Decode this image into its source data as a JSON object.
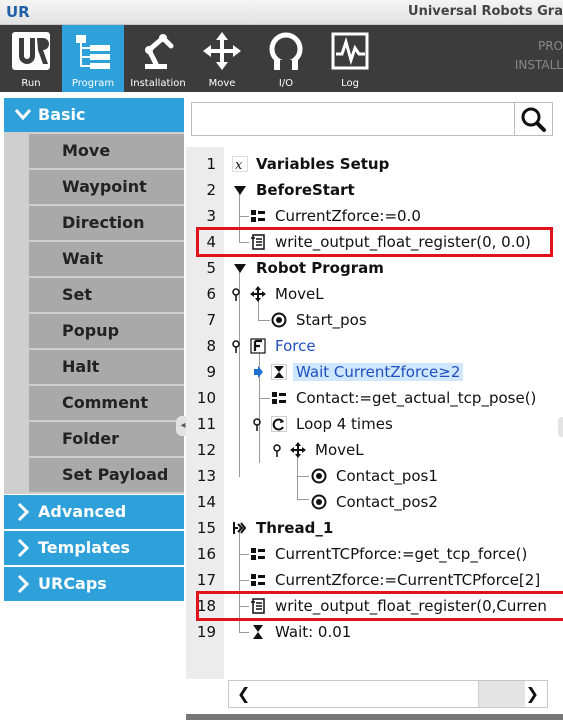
{
  "window": {
    "logo": "UR",
    "title": "Universal Robots Gra"
  },
  "toolbar": {
    "buttons": [
      {
        "label": "Run",
        "icon": "ur-logo-icon"
      },
      {
        "label": "Program",
        "icon": "program-tree-icon",
        "active": true
      },
      {
        "label": "Installation",
        "icon": "robot-arm-icon"
      },
      {
        "label": "Move",
        "icon": "move-cross-icon"
      },
      {
        "label": "I/O",
        "icon": "io-icon"
      },
      {
        "label": "Log",
        "icon": "log-waveform-icon"
      }
    ],
    "right_line1": "PRO",
    "right_line2": "INSTALL"
  },
  "sidebar": {
    "basic_label": "Basic",
    "basic_items": [
      "Move",
      "Waypoint",
      "Direction",
      "Wait",
      "Set",
      "Popup",
      "Halt",
      "Comment",
      "Folder",
      "Set Payload"
    ],
    "advanced_label": "Advanced",
    "templates_label": "Templates",
    "urcaps_label": "URCaps"
  },
  "search": {
    "placeholder": ""
  },
  "tree": {
    "rows": [
      {
        "num": "1",
        "text": "Variables Setup",
        "icon": "variable-x-icon"
      },
      {
        "num": "2",
        "text": "BeforeStart",
        "icon": "collapse-triangle-icon"
      },
      {
        "num": "3",
        "text": "CurrentZforce:=0.0",
        "icon": "assignment-icon"
      },
      {
        "num": "4",
        "text": "write_output_float_register(0, 0.0)",
        "icon": "script-icon"
      },
      {
        "num": "5",
        "text": "Robot Program",
        "icon": "collapse-triangle-icon"
      },
      {
        "num": "6",
        "text": "MoveL",
        "icon": "move-cross-icon"
      },
      {
        "num": "7",
        "text": "Start_pos",
        "icon": "waypoint-icon"
      },
      {
        "num": "8",
        "text": "Force",
        "icon": "force-icon"
      },
      {
        "num": "9",
        "text": "Wait CurrentZforce≥2",
        "icon": "hourglass-icon"
      },
      {
        "num": "10",
        "text": "Contact:=get_actual_tcp_pose()",
        "icon": "assignment-icon"
      },
      {
        "num": "11",
        "text": "Loop 4 times",
        "icon": "loop-icon"
      },
      {
        "num": "12",
        "text": "MoveL",
        "icon": "move-cross-icon"
      },
      {
        "num": "13",
        "text": "Contact_pos1",
        "icon": "waypoint-icon"
      },
      {
        "num": "14",
        "text": "Contact_pos2",
        "icon": "waypoint-icon"
      },
      {
        "num": "15",
        "text": "Thread_1",
        "icon": "thread-icon"
      },
      {
        "num": "16",
        "text": "CurrentTCPforce:=get_tcp_force()",
        "icon": "assignment-icon"
      },
      {
        "num": "17",
        "text": "CurrentZforce:=CurrentTCPforce[2]",
        "icon": "assignment-icon"
      },
      {
        "num": "18",
        "text": "write_output_float_register(0,Curren",
        "icon": "script-icon"
      },
      {
        "num": "19",
        "text": "Wait: 0.01",
        "icon": "hourglass-icon"
      }
    ]
  },
  "colors": {
    "accent": "#2ea0da",
    "highlight_box": "#e0121b",
    "selected_row": "#cfe6ff",
    "force_text": "#1f4fbf"
  }
}
